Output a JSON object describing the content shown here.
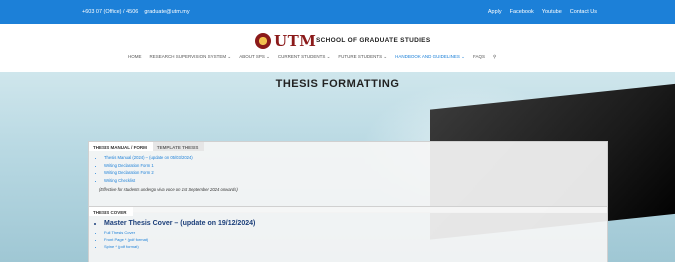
{
  "topbar": {
    "phone": "+603 07 (Office) / 4506",
    "email": "graduate@utm.my",
    "links": [
      "Apply",
      "Facebook",
      "Youtube",
      "Contact Us"
    ]
  },
  "header": {
    "logo_text": "UTM",
    "school_title": "SCHOOL OF GRADUATE STUDIES"
  },
  "nav": {
    "items": [
      "HOME",
      "RESEARCH SUPERVISION SYSTEM ⌄",
      "ABOUT SPS ⌄",
      "CURRENT STUDENTS ⌄",
      "FUTURE STUDENTS ⌄",
      "HANDBOOK AND GUIDELINES ⌄",
      "FAQS"
    ],
    "active_index": 5
  },
  "page": {
    "title": "THESIS FORMATTING"
  },
  "panel1": {
    "tabs": [
      "THESIS MANUAL / FORM",
      "TEMPLATE THESIS"
    ],
    "items": [
      "Thesis Manual (2024) – (update on 05/03/2024)",
      "Writing Declaration Form 1",
      "Writing Declaration Form 2",
      "Writing Checklist"
    ],
    "note": "(Effective for students undergo viva voce on 1st September 2024 onwards)"
  },
  "panel2": {
    "tabs": [
      "THESIS COVER"
    ],
    "title": "Master Thesis Cover – (update on 19/12/2024)",
    "items": [
      "Full Thesis Cover",
      "Front Page * (pdf format)",
      "Spine * (pdf format)"
    ]
  }
}
